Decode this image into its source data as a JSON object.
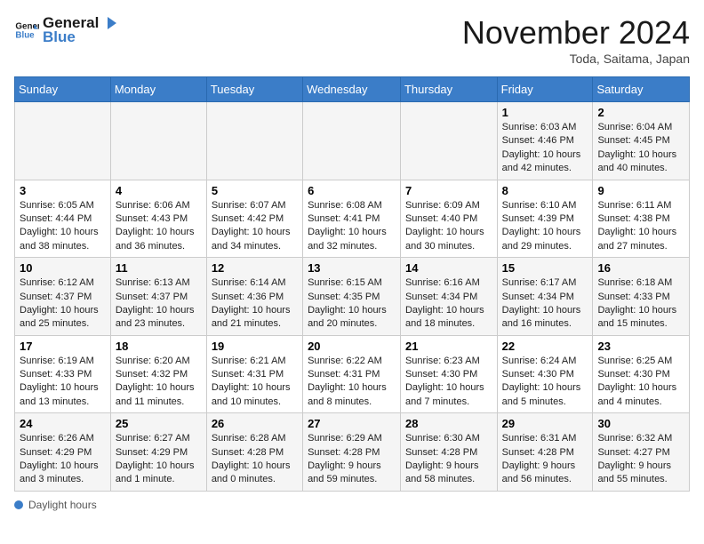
{
  "logo": {
    "line1": "General",
    "line2": "Blue"
  },
  "title": "November 2024",
  "location": "Toda, Saitama, Japan",
  "weekdays": [
    "Sunday",
    "Monday",
    "Tuesday",
    "Wednesday",
    "Thursday",
    "Friday",
    "Saturday"
  ],
  "weeks": [
    [
      {
        "day": "",
        "info": ""
      },
      {
        "day": "",
        "info": ""
      },
      {
        "day": "",
        "info": ""
      },
      {
        "day": "",
        "info": ""
      },
      {
        "day": "",
        "info": ""
      },
      {
        "day": "1",
        "info": "Sunrise: 6:03 AM\nSunset: 4:46 PM\nDaylight: 10 hours\nand 42 minutes."
      },
      {
        "day": "2",
        "info": "Sunrise: 6:04 AM\nSunset: 4:45 PM\nDaylight: 10 hours\nand 40 minutes."
      }
    ],
    [
      {
        "day": "3",
        "info": "Sunrise: 6:05 AM\nSunset: 4:44 PM\nDaylight: 10 hours\nand 38 minutes."
      },
      {
        "day": "4",
        "info": "Sunrise: 6:06 AM\nSunset: 4:43 PM\nDaylight: 10 hours\nand 36 minutes."
      },
      {
        "day": "5",
        "info": "Sunrise: 6:07 AM\nSunset: 4:42 PM\nDaylight: 10 hours\nand 34 minutes."
      },
      {
        "day": "6",
        "info": "Sunrise: 6:08 AM\nSunset: 4:41 PM\nDaylight: 10 hours\nand 32 minutes."
      },
      {
        "day": "7",
        "info": "Sunrise: 6:09 AM\nSunset: 4:40 PM\nDaylight: 10 hours\nand 30 minutes."
      },
      {
        "day": "8",
        "info": "Sunrise: 6:10 AM\nSunset: 4:39 PM\nDaylight: 10 hours\nand 29 minutes."
      },
      {
        "day": "9",
        "info": "Sunrise: 6:11 AM\nSunset: 4:38 PM\nDaylight: 10 hours\nand 27 minutes."
      }
    ],
    [
      {
        "day": "10",
        "info": "Sunrise: 6:12 AM\nSunset: 4:37 PM\nDaylight: 10 hours\nand 25 minutes."
      },
      {
        "day": "11",
        "info": "Sunrise: 6:13 AM\nSunset: 4:37 PM\nDaylight: 10 hours\nand 23 minutes."
      },
      {
        "day": "12",
        "info": "Sunrise: 6:14 AM\nSunset: 4:36 PM\nDaylight: 10 hours\nand 21 minutes."
      },
      {
        "day": "13",
        "info": "Sunrise: 6:15 AM\nSunset: 4:35 PM\nDaylight: 10 hours\nand 20 minutes."
      },
      {
        "day": "14",
        "info": "Sunrise: 6:16 AM\nSunset: 4:34 PM\nDaylight: 10 hours\nand 18 minutes."
      },
      {
        "day": "15",
        "info": "Sunrise: 6:17 AM\nSunset: 4:34 PM\nDaylight: 10 hours\nand 16 minutes."
      },
      {
        "day": "16",
        "info": "Sunrise: 6:18 AM\nSunset: 4:33 PM\nDaylight: 10 hours\nand 15 minutes."
      }
    ],
    [
      {
        "day": "17",
        "info": "Sunrise: 6:19 AM\nSunset: 4:33 PM\nDaylight: 10 hours\nand 13 minutes."
      },
      {
        "day": "18",
        "info": "Sunrise: 6:20 AM\nSunset: 4:32 PM\nDaylight: 10 hours\nand 11 minutes."
      },
      {
        "day": "19",
        "info": "Sunrise: 6:21 AM\nSunset: 4:31 PM\nDaylight: 10 hours\nand 10 minutes."
      },
      {
        "day": "20",
        "info": "Sunrise: 6:22 AM\nSunset: 4:31 PM\nDaylight: 10 hours\nand 8 minutes."
      },
      {
        "day": "21",
        "info": "Sunrise: 6:23 AM\nSunset: 4:30 PM\nDaylight: 10 hours\nand 7 minutes."
      },
      {
        "day": "22",
        "info": "Sunrise: 6:24 AM\nSunset: 4:30 PM\nDaylight: 10 hours\nand 5 minutes."
      },
      {
        "day": "23",
        "info": "Sunrise: 6:25 AM\nSunset: 4:30 PM\nDaylight: 10 hours\nand 4 minutes."
      }
    ],
    [
      {
        "day": "24",
        "info": "Sunrise: 6:26 AM\nSunset: 4:29 PM\nDaylight: 10 hours\nand 3 minutes."
      },
      {
        "day": "25",
        "info": "Sunrise: 6:27 AM\nSunset: 4:29 PM\nDaylight: 10 hours\nand 1 minute."
      },
      {
        "day": "26",
        "info": "Sunrise: 6:28 AM\nSunset: 4:28 PM\nDaylight: 10 hours\nand 0 minutes."
      },
      {
        "day": "27",
        "info": "Sunrise: 6:29 AM\nSunset: 4:28 PM\nDaylight: 9 hours\nand 59 minutes."
      },
      {
        "day": "28",
        "info": "Sunrise: 6:30 AM\nSunset: 4:28 PM\nDaylight: 9 hours\nand 58 minutes."
      },
      {
        "day": "29",
        "info": "Sunrise: 6:31 AM\nSunset: 4:28 PM\nDaylight: 9 hours\nand 56 minutes."
      },
      {
        "day": "30",
        "info": "Sunrise: 6:32 AM\nSunset: 4:27 PM\nDaylight: 9 hours\nand 55 minutes."
      }
    ]
  ],
  "footer": {
    "dot_label": "Daylight hours"
  }
}
